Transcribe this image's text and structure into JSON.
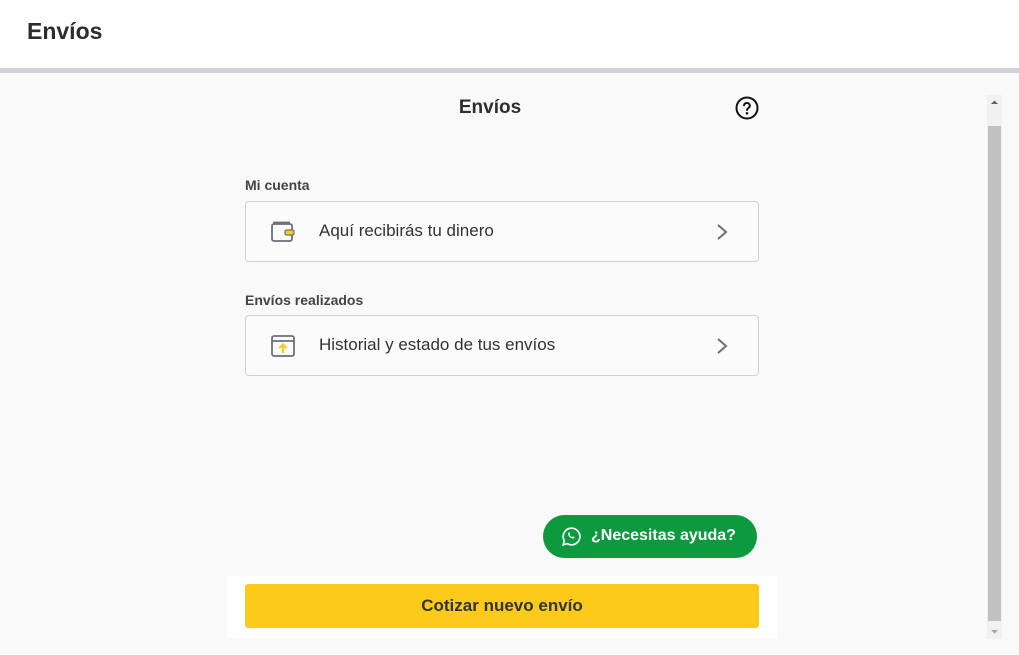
{
  "topbar": {
    "title": "Envíos"
  },
  "panel": {
    "title": "Envíos",
    "help_icon": "question-circle-icon"
  },
  "sections": [
    {
      "label": "Mi cuenta",
      "card_text": "Aquí recibirás tu dinero",
      "icon": "wallet-icon"
    },
    {
      "label": "Envíos realizados",
      "card_text": "Historial y estado de tus envíos",
      "icon": "package-history-icon"
    }
  ],
  "help_button": {
    "label": "¿Necesitas ayuda?",
    "icon": "whatsapp-icon",
    "color": "#0d9a3f"
  },
  "footer": {
    "primary_label": "Cotizar nuevo envío",
    "primary_color": "#fccb19"
  },
  "colors": {
    "accent": "#fccb19",
    "whatsapp_green": "#0d9a3f"
  }
}
